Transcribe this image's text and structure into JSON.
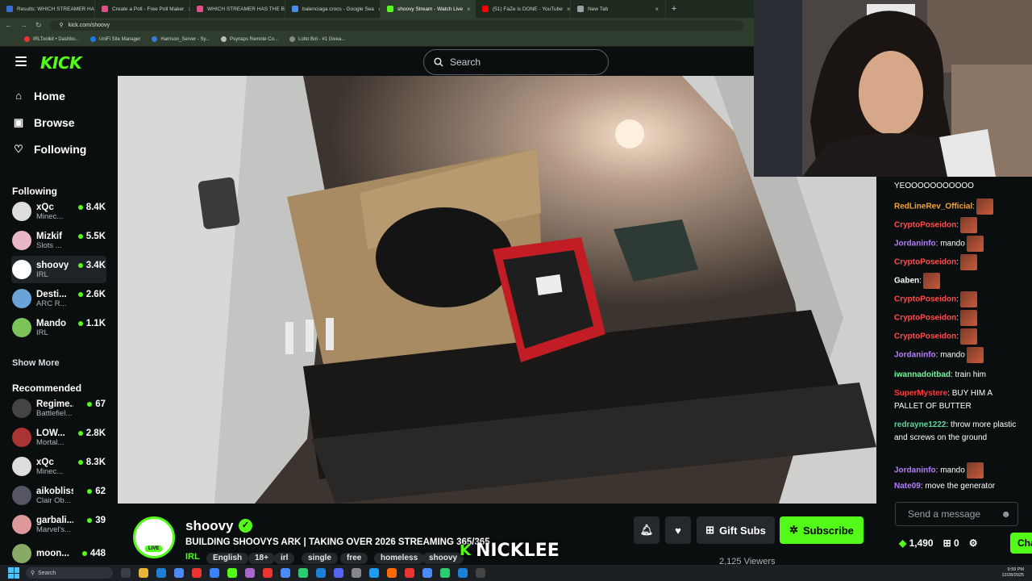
{
  "browser": {
    "tabs": [
      {
        "label": "Results: WHICH STREAMER HA",
        "color": "#3b6fd6",
        "active": false
      },
      {
        "label": "Create a Poll - Free Poll Maker",
        "color": "#e04f8a",
        "active": false
      },
      {
        "label": "WHICH STREAMER HAS THE B",
        "color": "#e04f8a",
        "active": false
      },
      {
        "label": "balenciaga crocs - Google Sea",
        "color": "#4c8bf5",
        "active": false
      },
      {
        "label": "shoovy Stream - Watch Live",
        "color": "#53fc18",
        "active": true
      },
      {
        "label": "(51) FaZe is DONE - YouTube",
        "color": "#ff0000",
        "active": false
      },
      {
        "label": "New Tab",
        "color": "#9aa0a6",
        "active": false
      }
    ],
    "url": "kick.com/shoovy",
    "bookmarks": [
      {
        "label": "IRLToolkit • Dashbo...",
        "color": "#e33"
      },
      {
        "label": "UniFi Site Manager",
        "color": "#1f7ae0"
      },
      {
        "label": "Harrison_Server - Sy...",
        "color": "#3a7bd5"
      },
      {
        "label": "Psynaps Remote Co...",
        "color": "#bbb"
      },
      {
        "label": "Lotto Bot - #1 Givea...",
        "color": "#888"
      }
    ]
  },
  "header": {
    "logo": "KICK",
    "search_placeholder": "Search"
  },
  "sidebar": {
    "nav": [
      {
        "label": "Home",
        "icon": "⌂"
      },
      {
        "label": "Browse",
        "icon": "▣"
      },
      {
        "label": "Following",
        "icon": "♡"
      }
    ],
    "following_title": "Following",
    "following": [
      {
        "name": "xQc",
        "count": "8.4K",
        "game": "Minec...",
        "color": "#ddd"
      },
      {
        "name": "Mizkif",
        "count": "5.5K",
        "game": "Slots ...",
        "color": "#e8b6c8"
      },
      {
        "name": "shoovy",
        "count": "3.4K",
        "game": "IRL",
        "color": "#ffffff"
      },
      {
        "name": "Desti...",
        "count": "2.6K",
        "game": "ARC R...",
        "color": "#6aa3d8"
      },
      {
        "name": "Mando",
        "count": "1.1K",
        "game": "IRL",
        "color": "#7cc35a"
      }
    ],
    "show_more": "Show More",
    "recommended_title": "Recommended",
    "recommended": [
      {
        "name": "Regime...",
        "count": "67",
        "game": "Battlefiel...",
        "color": "#444"
      },
      {
        "name": "LOW...",
        "count": "2.8K",
        "game": "Mortal...",
        "color": "#a33"
      },
      {
        "name": "xQc",
        "count": "8.3K",
        "game": "Minec...",
        "color": "#ddd"
      },
      {
        "name": "aikobliss",
        "count": "62",
        "game": "Clair Ob...",
        "color": "#556"
      },
      {
        "name": "garbali...",
        "count": "39",
        "game": "Marvel's...",
        "color": "#d99"
      },
      {
        "name": "moon...",
        "count": "448",
        "game": "",
        "color": "#8a6"
      }
    ]
  },
  "chat": {
    "messages": [
      {
        "user": "",
        "color": "#fff",
        "text": "YEOOOOOOOOOOO",
        "emote": false
      },
      {
        "user": "RedLineRev_Official",
        "color": "#f2a33a",
        "text": "",
        "emote": true
      },
      {
        "user": "CryptoPoseidon",
        "color": "#ff4d4d",
        "text": "",
        "emote": true
      },
      {
        "user": "Jordaninfo",
        "color": "#b57bff",
        "text": " mando",
        "emote": true
      },
      {
        "user": "CryptoPoseidon",
        "color": "#ff4d4d",
        "text": "",
        "emote": true
      },
      {
        "user": "Gaben",
        "color": "#fff",
        "text": "",
        "emote": true
      },
      {
        "user": "CryptoPoseidon",
        "color": "#ff4d4d",
        "text": "",
        "emote": true
      },
      {
        "user": "CryptoPoseidon",
        "color": "#ff4d4d",
        "text": "",
        "emote": true
      },
      {
        "user": "CryptoPoseidon",
        "color": "#ff4d4d",
        "text": "",
        "emote": true
      },
      {
        "user": "Jordaninfo",
        "color": "#b57bff",
        "text": " mando",
        "emote": true
      },
      {
        "user": "iwannadoitbad",
        "color": "#7cf2a0",
        "text": " train him",
        "emote": false
      },
      {
        "user": "SuperMystere",
        "color": "#ff3b3b",
        "text": " BUY HIM A PALLET OF BUTTER",
        "emote": false
      },
      {
        "user": "redrayne1222",
        "color": "#5fd49a",
        "text": " throw more plastic and screws on the ground",
        "emote": false
      },
      {
        "user": "Jordaninfo",
        "color": "#b57bff",
        "text": " mando",
        "emote": true
      },
      {
        "user": "Nate09",
        "color": "#b57bff",
        "text": " move the generator",
        "emote": false
      }
    ],
    "input_placeholder": "Send a message",
    "points": "1,490",
    "gifts": "0",
    "chat_button": "Chat"
  },
  "stream": {
    "streamer": "shoovy",
    "live_badge": "LIVE",
    "title": "BUILDING SHOOVYS ARK | TAKING OVER 2026 STREAMING 365/365",
    "category": "IRL",
    "tags": [
      "English",
      "18+",
      "irl",
      "single",
      "free",
      "homeless",
      "shoovy"
    ],
    "viewers": "2,125 Viewers",
    "gift_subs": "Gift Subs",
    "subscribe": "Subscribe",
    "watermark": "NICKLEE"
  },
  "taskbar": {
    "search_placeholder": "Search",
    "time": "9:59 PM",
    "date": "12/28/2025"
  },
  "colors": {
    "accent": "#53fc18",
    "bg": "#0b0e0f"
  }
}
